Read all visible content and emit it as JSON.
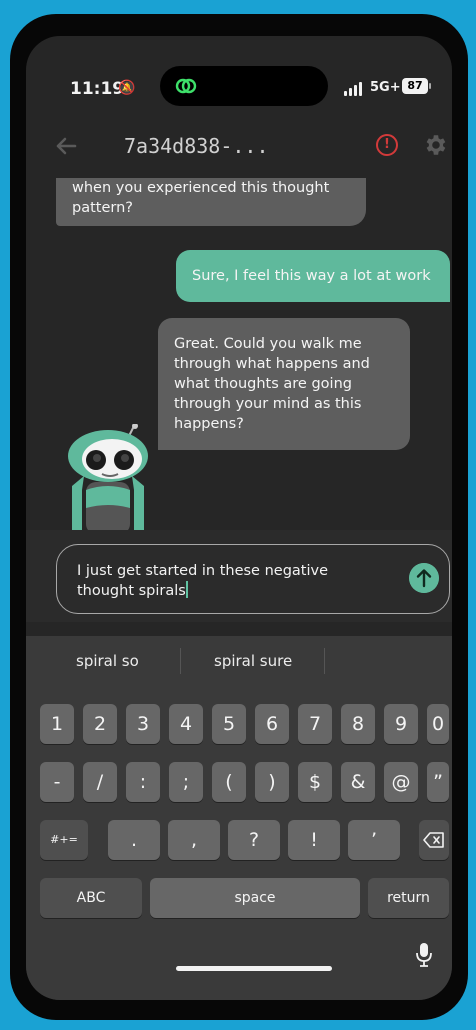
{
  "status_bar": {
    "time": "11:19",
    "network": "5G+",
    "battery": "87"
  },
  "header": {
    "title": "7a34d838-..."
  },
  "messages": [
    {
      "sender": "bot",
      "text": "when you experienced this thought pattern?"
    },
    {
      "sender": "user",
      "text": "Sure, I feel this way a lot at work"
    },
    {
      "sender": "bot",
      "text": "Great. Could you walk me through what happens and what thoughts are going through your mind as this happens?"
    }
  ],
  "input": {
    "value": "I just get started in these negative thought spirals"
  },
  "keyboard": {
    "suggestions": [
      "spiral so",
      "spiral sure"
    ],
    "row1": [
      "1",
      "2",
      "3",
      "4",
      "5",
      "6",
      "7",
      "8",
      "9",
      "0"
    ],
    "row2": [
      "-",
      "/",
      ":",
      ";",
      "(",
      ")",
      "$",
      "&",
      "@",
      "”"
    ],
    "row3_left": "#+=",
    "row3": [
      ".",
      ",",
      "?",
      "!",
      "’"
    ],
    "abc": "ABC",
    "space": "space",
    "return": "return"
  },
  "colors": {
    "accent": "#5fb99c",
    "alert": "#d23a3a",
    "bot_bubble": "#5e5e5e"
  }
}
